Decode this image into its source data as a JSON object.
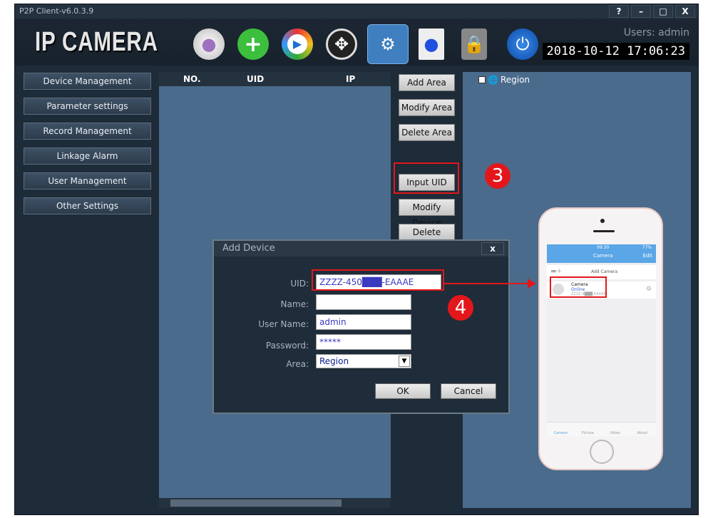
{
  "window": {
    "title": "P2P Client-v6.0.3.9",
    "controls": [
      "?",
      "–",
      "□",
      "X"
    ]
  },
  "header": {
    "logo": "IP CAMERA",
    "users": "Users: admin",
    "datetime": "2018-10-12 17:06:23",
    "tools": [
      "camera-icon",
      "add-icon",
      "playback-icon",
      "film-reel-icon",
      "settings-icon",
      "log-icon",
      "lock-icon",
      "power-icon"
    ]
  },
  "sidebar": {
    "items": [
      "Device Management",
      "Parameter settings",
      "Record Management",
      "Linkage Alarm",
      "User Management",
      "Other Settings"
    ]
  },
  "table": {
    "columns": [
      "NO.",
      "UID",
      "IP"
    ]
  },
  "actions": [
    "Add Area",
    "Modify Area",
    "Delete Area",
    "Input UID",
    "Modify Device",
    "Delete Device"
  ],
  "tree": {
    "root": "Region"
  },
  "steps": [
    "3",
    "4"
  ],
  "dialog": {
    "title": "Add Device",
    "close": "x",
    "labels": {
      "uid": "UID:",
      "name": "Name:",
      "user": "User Name:",
      "password": "Password:",
      "area": "Area:"
    },
    "values": {
      "uid": "ZZZZ-450███-EAAAE",
      "name": "",
      "user": "admin",
      "password": "*****",
      "area": "Region"
    },
    "ok": "OK",
    "cancel": "Cancel"
  },
  "phone": {
    "time": "09:30",
    "battery": "77%",
    "title": "Camera",
    "edit": "Edit",
    "add": "Add Camera",
    "device": {
      "name": "Camera",
      "status": "Online",
      "uid": "ZZZZ-4███-EAAAE"
    },
    "tabs": [
      "Camera",
      "Picture",
      "Video",
      "About"
    ]
  },
  "colors": {
    "accent_red": "#e3171b",
    "panel": "#4a6b8c",
    "phone_bar": "#5aa6e6"
  }
}
